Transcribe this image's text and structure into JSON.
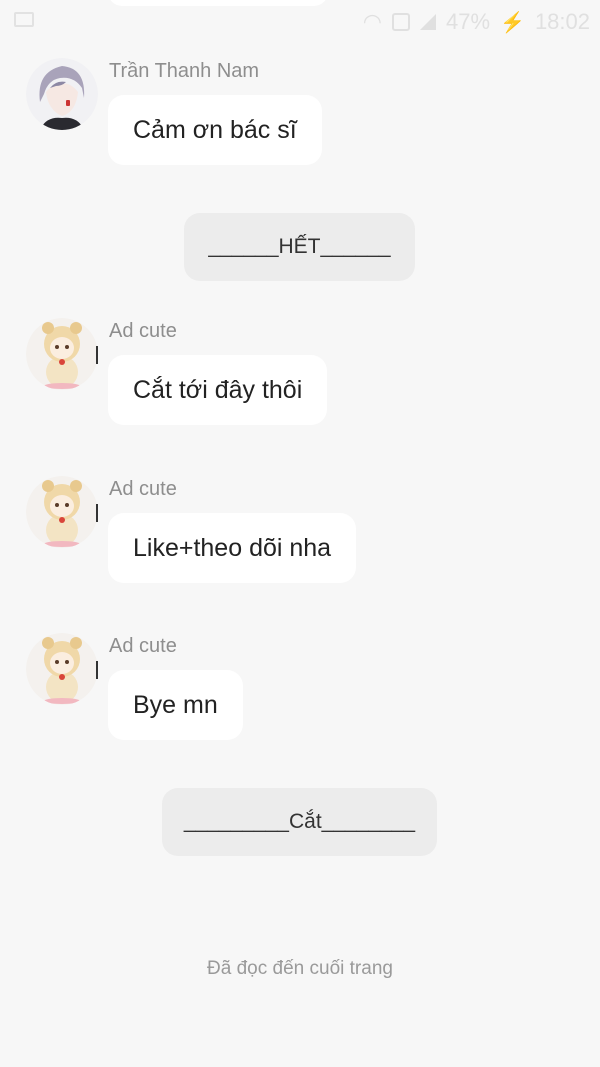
{
  "status_bar": {
    "battery": "47%",
    "time": "18:02"
  },
  "messages": [
    {
      "sender": "Trần Thanh Nam",
      "text": "Cảm ơn bác sĩ"
    },
    {
      "sender": "Ad cute",
      "text": "Cắt tới đây thôi"
    },
    {
      "sender": "Ad cute",
      "text": "Like+theo dõi nha"
    },
    {
      "sender": "Ad cute",
      "text": "Bye mn"
    }
  ],
  "dividers": {
    "end": "______HẾT______",
    "cut": "_________Cắt________"
  },
  "footer": {
    "read_to_end": "Đã đọc đến cuối trang"
  },
  "colors": {
    "background": "#f7f7f7",
    "bubble": "#ffffff",
    "divider_bubble": "#ececec",
    "sender_name": "#8e8e8e",
    "footer_text": "#9a9a9a"
  }
}
